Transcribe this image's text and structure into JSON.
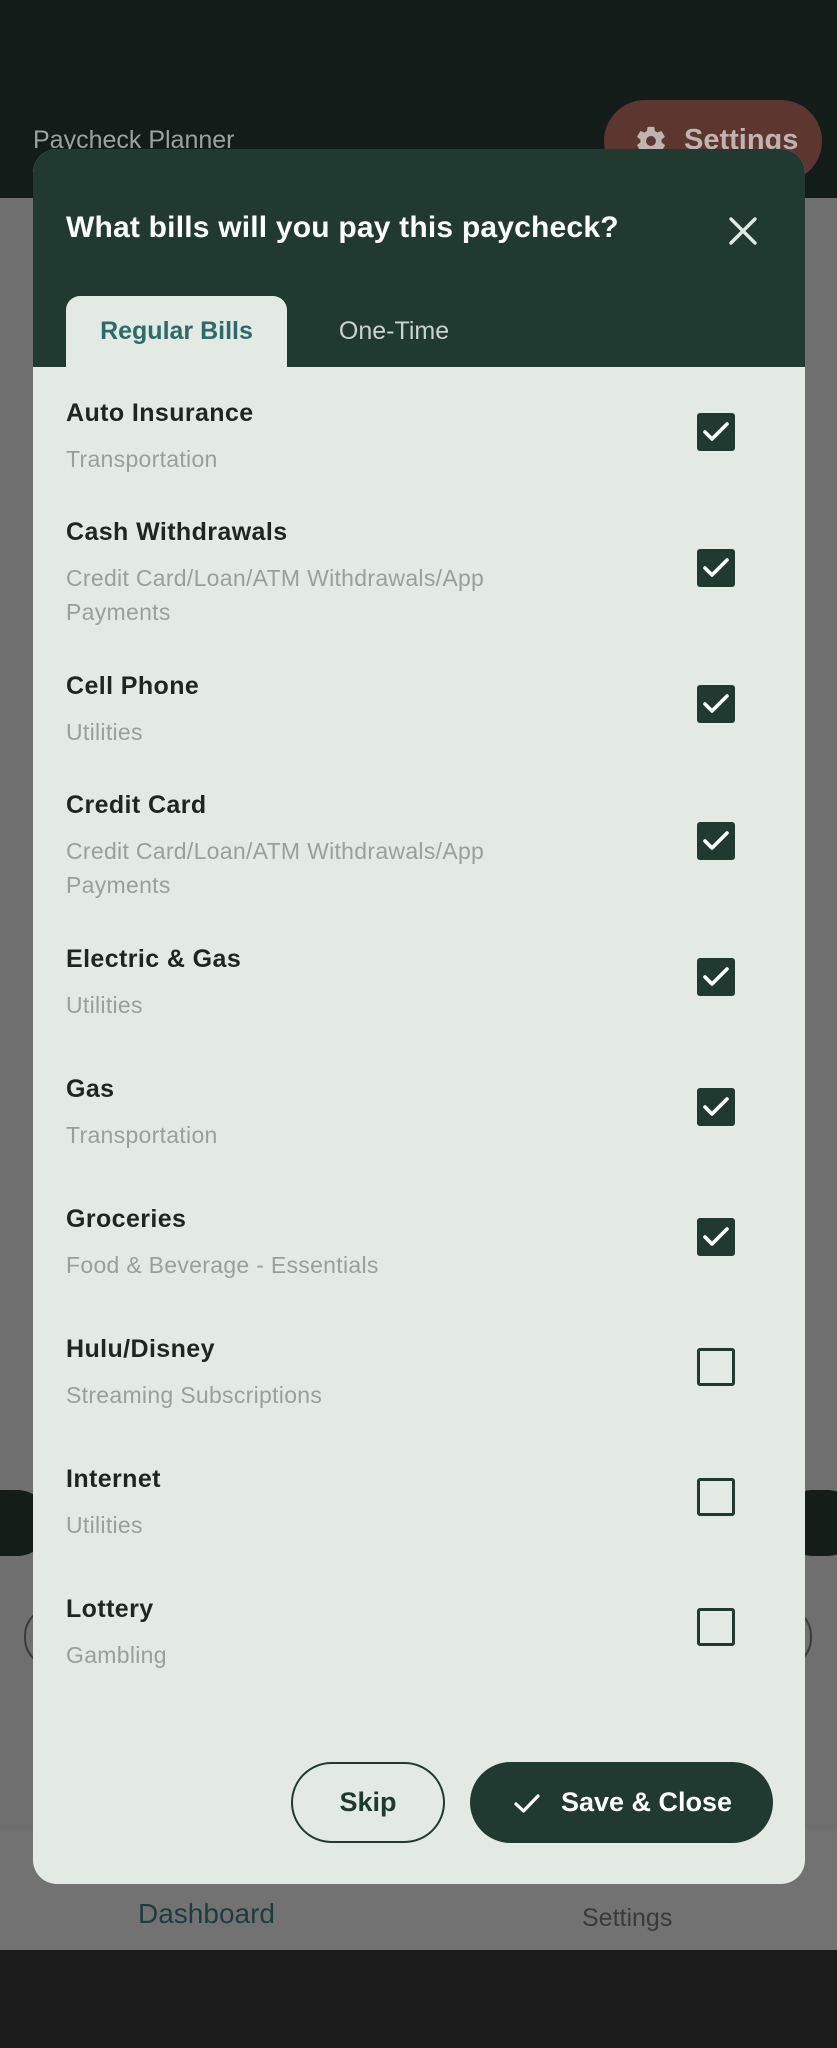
{
  "app": {
    "title": "Paycheck Planner",
    "settings_button": "Settings",
    "nav": {
      "dashboard": "Dashboard",
      "settings": "Settings"
    }
  },
  "dialog": {
    "title": "What bills will you pay this paycheck?",
    "tabs": [
      {
        "label": "Regular Bills",
        "selected": true
      },
      {
        "label": "One-Time",
        "selected": false
      }
    ],
    "bills": [
      {
        "name": "Auto Insurance",
        "category": "Transportation",
        "checked": true
      },
      {
        "name": "Cash Withdrawals",
        "category": "Credit Card/Loan/ATM Withdrawals/App Payments",
        "checked": true
      },
      {
        "name": "Cell Phone",
        "category": "Utilities",
        "checked": true
      },
      {
        "name": "Credit Card",
        "category": "Credit Card/Loan/ATM Withdrawals/App Payments",
        "checked": true
      },
      {
        "name": "Electric & Gas",
        "category": "Utilities",
        "checked": true
      },
      {
        "name": "Gas",
        "category": "Transportation",
        "checked": true
      },
      {
        "name": "Groceries",
        "category": "Food & Beverage - Essentials",
        "checked": true
      },
      {
        "name": "Hulu/Disney",
        "category": "Streaming Subscriptions",
        "checked": false
      },
      {
        "name": "Internet",
        "category": "Utilities",
        "checked": false
      },
      {
        "name": "Lottery",
        "category": "Gambling",
        "checked": false
      }
    ],
    "skip_label": "Skip",
    "save_label": "Save & Close"
  },
  "colors": {
    "primary": "#203a31",
    "surface": "#e3eae4",
    "tab_active_text": "#2d6b6a"
  }
}
